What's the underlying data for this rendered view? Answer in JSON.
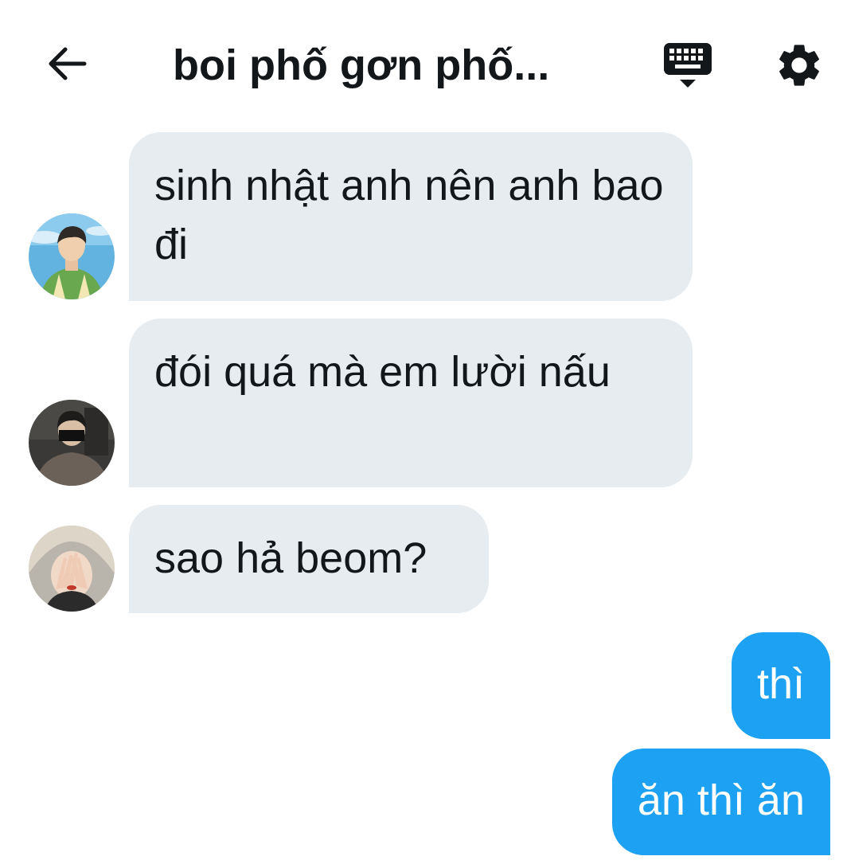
{
  "header": {
    "back_icon": "arrow-left-icon",
    "title": "boi phố gơn phố...",
    "keyboard_icon": "keyboard-icon",
    "settings_icon": "gear-icon"
  },
  "colors": {
    "incoming_bubble": "#e6ecf0",
    "outgoing_bubble": "#1da1f2",
    "text": "#14171a"
  },
  "messages": [
    {
      "direction": "incoming",
      "text": "sinh nhật anh nên anh bao đi",
      "avatar": "avatar-green-shirt"
    },
    {
      "direction": "incoming",
      "text": "đói quá mà em lười nấu",
      "avatar": "avatar-masked-dark"
    },
    {
      "direction": "incoming",
      "text": "sao hả beom?",
      "avatar": "avatar-blonde-hands"
    },
    {
      "direction": "outgoing",
      "text": "thì"
    },
    {
      "direction": "outgoing",
      "text": "ăn thì ăn"
    }
  ]
}
